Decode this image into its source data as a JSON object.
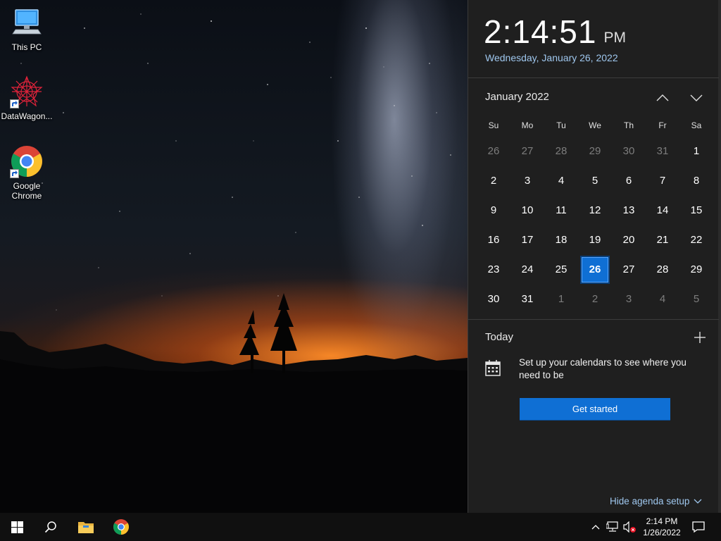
{
  "desktop": {
    "icons": [
      {
        "label": "This PC"
      },
      {
        "label": "DataWagon..."
      },
      {
        "label": "Google Chrome"
      }
    ]
  },
  "flyout": {
    "time": "2:14:51",
    "ampm": "PM",
    "long_date": "Wednesday, January 26, 2022",
    "month_year": "January 2022",
    "weekdays": [
      "Su",
      "Mo",
      "Tu",
      "We",
      "Th",
      "Fr",
      "Sa"
    ],
    "weeks": [
      [
        "26",
        "27",
        "28",
        "29",
        "30",
        "31",
        "1"
      ],
      [
        "2",
        "3",
        "4",
        "5",
        "6",
        "7",
        "8"
      ],
      [
        "9",
        "10",
        "11",
        "12",
        "13",
        "14",
        "15"
      ],
      [
        "16",
        "17",
        "18",
        "19",
        "20",
        "21",
        "22"
      ],
      [
        "23",
        "24",
        "25",
        "26",
        "27",
        "28",
        "29"
      ],
      [
        "30",
        "31",
        "1",
        "2",
        "3",
        "4",
        "5"
      ]
    ],
    "today_label": "Today",
    "agenda_message": "Set up your calendars to see where you need to be",
    "get_started_label": "Get started",
    "hide_agenda_label": "Hide agenda setup"
  },
  "taskbar": {
    "clock_time": "2:14 PM",
    "clock_date": "1/26/2022"
  },
  "colors": {
    "accent": "#0f6fd4",
    "link": "#9fc7ee",
    "flyout_bg": "#1f1f1f",
    "taskbar_bg": "#101010"
  }
}
